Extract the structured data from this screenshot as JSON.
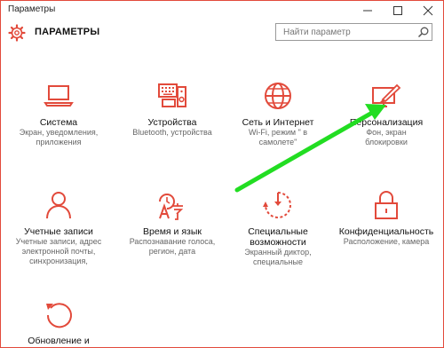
{
  "window": {
    "title": "Параметры"
  },
  "header": {
    "title": "ПАРАМЕТРЫ"
  },
  "search": {
    "placeholder": "Найти параметр"
  },
  "colors": {
    "accent": "#e24a3b",
    "arrow": "#22dd22"
  },
  "tiles": [
    {
      "name": "Система",
      "desc": "Экран, уведомления, приложения",
      "icon": "laptop-icon"
    },
    {
      "name": "Устройства",
      "desc": "Bluetooth, устройства",
      "icon": "devices-icon"
    },
    {
      "name": "Сеть и Интернет",
      "desc": "Wi-Fi, режим \" в самолете\"",
      "icon": "globe-icon"
    },
    {
      "name": "Персонализация",
      "desc": "Фон, экран блокировки",
      "icon": "paint-icon"
    },
    {
      "name": "Учетные записи",
      "desc": "Учетные записи, адрес электронной почты, синхронизация,",
      "icon": "person-icon"
    },
    {
      "name": "Время и язык",
      "desc": "Распознавание голоса, регион, дата",
      "icon": "time-language-icon"
    },
    {
      "name": "Специальные возможности",
      "desc": "Экранный диктор, специальные",
      "icon": "accessibility-icon"
    },
    {
      "name": "Конфиденциальность",
      "desc": "Расположение, камера",
      "icon": "lock-icon"
    },
    {
      "name": "Обновление и",
      "desc": "",
      "icon": "update-icon"
    }
  ]
}
